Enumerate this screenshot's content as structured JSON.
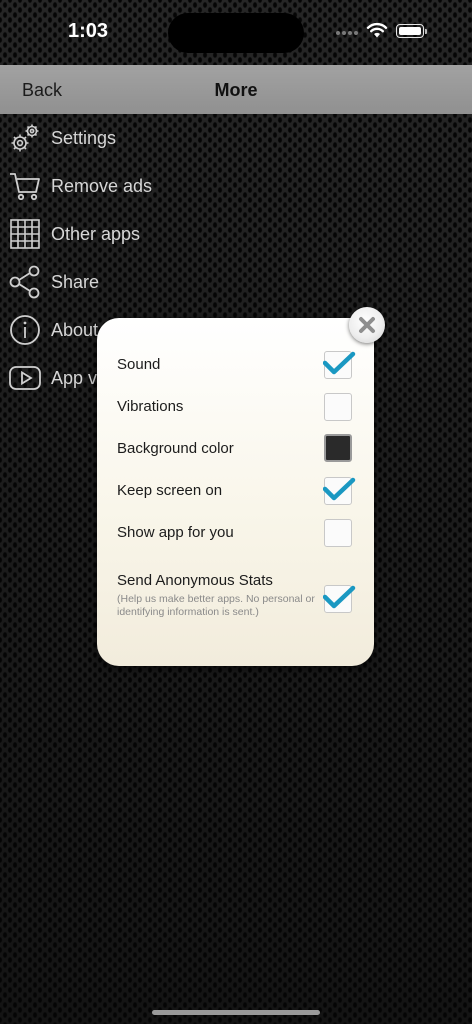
{
  "status_bar": {
    "time": "1:03"
  },
  "navbar": {
    "back_label": "Back",
    "title": "More"
  },
  "menu": {
    "items": [
      {
        "label": "Settings",
        "icon": "gear-icon"
      },
      {
        "label": "Remove ads",
        "icon": "cart-icon"
      },
      {
        "label": "Other apps",
        "icon": "grid-icon"
      },
      {
        "label": "Share",
        "icon": "share-icon"
      },
      {
        "label": "About",
        "icon": "info-icon"
      },
      {
        "label": "App v",
        "icon": "video-icon"
      }
    ]
  },
  "settings_dialog": {
    "options": [
      {
        "label": "Sound",
        "checked": true
      },
      {
        "label": "Vibrations",
        "checked": false
      },
      {
        "label": "Background color",
        "color_swatch": "#2a2a2a"
      },
      {
        "label": "Keep screen on",
        "checked": true
      },
      {
        "label": "Show app for you",
        "checked": false
      },
      {
        "label": "Send Anonymous Stats",
        "description": "(Help us make better apps. No personal or identifying information is sent.)",
        "checked": true
      }
    ],
    "check_color": "#1a98c2"
  }
}
